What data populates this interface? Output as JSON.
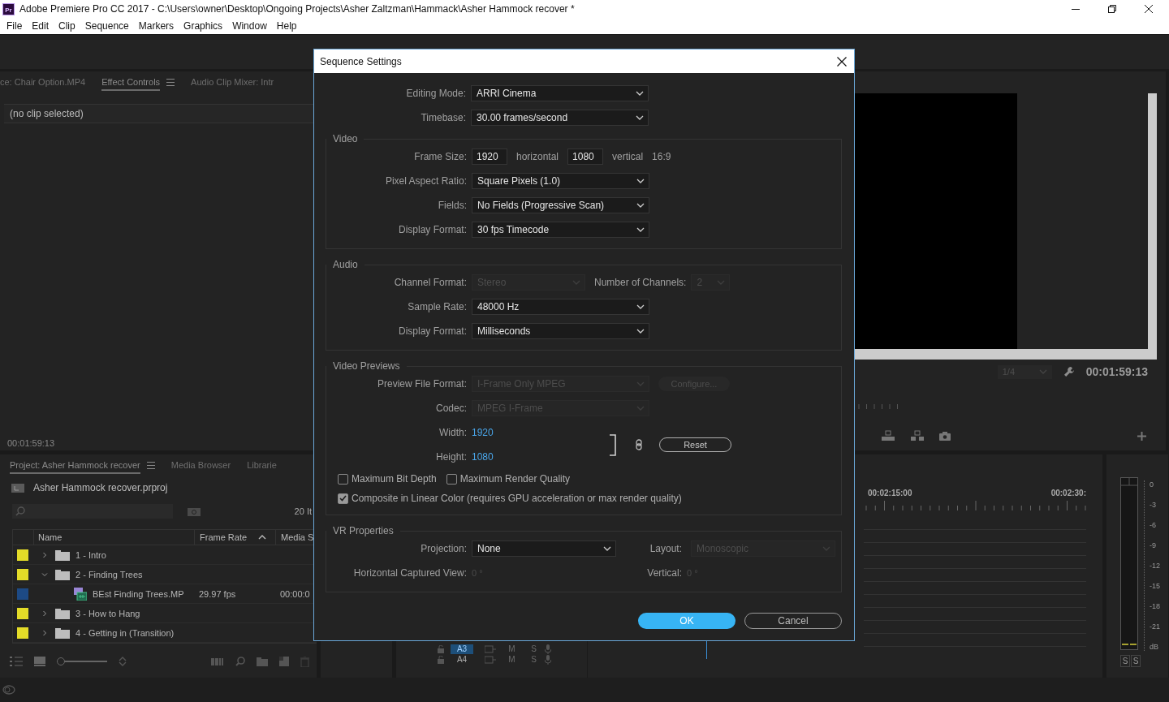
{
  "window": {
    "logo": "Pr",
    "title": "Adobe Premiere Pro CC 2017 - C:\\Users\\owner\\Desktop\\Ongoing Projects\\Asher Zaltzman\\Hammack\\Asher Hammock recover *"
  },
  "menu": [
    "File",
    "Edit",
    "Clip",
    "Sequence",
    "Markers",
    "Graphics",
    "Window",
    "Help"
  ],
  "effect_panel": {
    "tabs": [
      {
        "label": "ce: Chair Option.MP4",
        "selected": false
      },
      {
        "label": "Effect Controls",
        "selected": true
      },
      {
        "label": "Audio Clip Mixer: Intr",
        "selected": false
      }
    ],
    "message": "(no clip selected)",
    "timecode": "00:01:59:13"
  },
  "program_monitor": {
    "zoom": "1/4",
    "timecode": "00:01:59:13"
  },
  "project_panel": {
    "tabs": [
      {
        "label": "Project: Asher Hammock recover",
        "selected": true
      },
      {
        "label": "Media Browser",
        "selected": false
      },
      {
        "label": "Librarie",
        "selected": false
      }
    ],
    "file": "Asher Hammock recover.prproj",
    "zoom_slider": {
      "level": 0
    },
    "item_count": "20 It",
    "columns": [
      "Name",
      "Frame Rate",
      "Media S"
    ],
    "rows": [
      {
        "kind": "bin",
        "name": "1 - Intro",
        "color": "#e4dc28",
        "expanded": false
      },
      {
        "kind": "bin",
        "name": "2 - Finding Trees",
        "color": "#e4dc28",
        "expanded": true,
        "children": [
          {
            "kind": "clip",
            "name": "BEst Finding Trees.MP",
            "color": "#1d4a85",
            "frame_rate": "29.97 fps",
            "media_start": "00:00:0"
          }
        ]
      },
      {
        "kind": "bin",
        "name": "3 - How to Hang",
        "color": "#e4dc28",
        "expanded": false
      },
      {
        "kind": "bin",
        "name": "4 - Getting in (Transition)",
        "color": "#e4dc28",
        "expanded": false
      }
    ]
  },
  "timeline": {
    "ruler": [
      "00:02:15:00",
      "00:02:30:"
    ],
    "tracks": [
      {
        "name": "A3",
        "selected": true,
        "mute": "M",
        "solo": "S"
      },
      {
        "name": "A4",
        "selected": false,
        "mute": "M",
        "solo": "S"
      }
    ]
  },
  "audio_meter": {
    "scale": [
      "0",
      "-3",
      "-6",
      "-9",
      "-12",
      "-15",
      "-18",
      "-21",
      "dB"
    ],
    "solo_buttons": [
      "S",
      "S"
    ]
  },
  "dialog": {
    "title": "Sequence Settings",
    "rows": [
      {
        "kind": "field",
        "label": "Editing Mode:",
        "controls": [
          {
            "kind": "dropdown",
            "value": "ARRI Cinema",
            "disabled": false
          }
        ]
      },
      {
        "kind": "field",
        "label": "Timebase:",
        "controls": [
          {
            "kind": "dropdown",
            "value": "30.00  frames/second",
            "disabled": false
          }
        ]
      }
    ],
    "sections": [
      {
        "title": "Video",
        "rows": [
          {
            "kind": "field",
            "label": "Frame Size:",
            "controls": [
              {
                "kind": "input",
                "value": "1920"
              },
              {
                "kind": "text",
                "value": "horizontal"
              },
              {
                "kind": "input",
                "value": "1080"
              },
              {
                "kind": "text",
                "value": "vertical"
              },
              {
                "kind": "text",
                "value": "16:9"
              }
            ]
          },
          {
            "kind": "field",
            "label": "Pixel Aspect Ratio:",
            "controls": [
              {
                "kind": "dropdown",
                "value": "Square Pixels (1.0)",
                "disabled": false
              }
            ]
          },
          {
            "kind": "field",
            "label": "Fields:",
            "controls": [
              {
                "kind": "dropdown",
                "value": "No Fields (Progressive Scan)",
                "disabled": false
              }
            ]
          },
          {
            "kind": "field",
            "label": "Display Format:",
            "controls": [
              {
                "kind": "dropdown",
                "value": "30 fps Timecode",
                "disabled": false
              }
            ]
          }
        ]
      },
      {
        "title": "Audio",
        "rows": [
          {
            "kind": "field",
            "label": "Channel Format:",
            "controls": [
              {
                "kind": "short_dropdown",
                "value": "Stereo",
                "disabled": true
              },
              {
                "kind": "label",
                "value": "Number of Channels:"
              },
              {
                "kind": "mini_dropdown",
                "value": "2",
                "disabled": true
              }
            ]
          },
          {
            "kind": "field",
            "label": "Sample Rate:",
            "controls": [
              {
                "kind": "dropdown",
                "value": "48000 Hz",
                "disabled": false
              }
            ]
          },
          {
            "kind": "field",
            "label": "Display Format:",
            "controls": [
              {
                "kind": "dropdown",
                "value": "Milliseconds",
                "disabled": false
              }
            ]
          }
        ]
      },
      {
        "title": "Video Previews",
        "rows": [
          {
            "kind": "field",
            "label": "Preview File Format:",
            "controls": [
              {
                "kind": "dropdown",
                "value": "I-Frame Only MPEG",
                "disabled": true
              },
              {
                "kind": "button",
                "value": "Configure...",
                "disabled": true
              }
            ]
          },
          {
            "kind": "field",
            "label": "Codec:",
            "controls": [
              {
                "kind": "dropdown",
                "value": "MPEG I-Frame",
                "disabled": true
              }
            ]
          },
          {
            "kind": "linked_size",
            "sizes": [
              {
                "label": "Width:",
                "value": "1920"
              },
              {
                "label": "Height:",
                "value": "1080"
              }
            ],
            "reset": "Reset"
          },
          {
            "kind": "checkboxes",
            "items": [
              {
                "label": "Maximum Bit Depth",
                "checked": false
              },
              {
                "label": "Maximum Render Quality",
                "checked": false
              }
            ]
          },
          {
            "kind": "checkboxes",
            "items": [
              {
                "label": "Composite in Linear Color (requires GPU acceleration or max render quality)",
                "checked": true
              }
            ]
          }
        ]
      },
      {
        "title": "VR Properties",
        "rows": [
          {
            "kind": "field",
            "label": "Projection:",
            "controls": [
              {
                "kind": "mid_dropdown",
                "value": "None",
                "disabled": false
              },
              {
                "kind": "label",
                "value": "Layout:"
              },
              {
                "kind": "mid_dropdown",
                "value": "Monoscopic",
                "disabled": true
              }
            ]
          },
          {
            "kind": "field",
            "label": "Horizontal Captured View:",
            "controls": [
              {
                "kind": "angle",
                "value": "0 °",
                "disabled": true
              },
              {
                "kind": "label",
                "value": "Vertical:"
              },
              {
                "kind": "angle",
                "value": "0 °",
                "disabled": true
              }
            ]
          }
        ]
      }
    ],
    "buttons": [
      {
        "label": "OK",
        "kind": "primary"
      },
      {
        "label": "Cancel",
        "kind": "secondary"
      }
    ]
  }
}
